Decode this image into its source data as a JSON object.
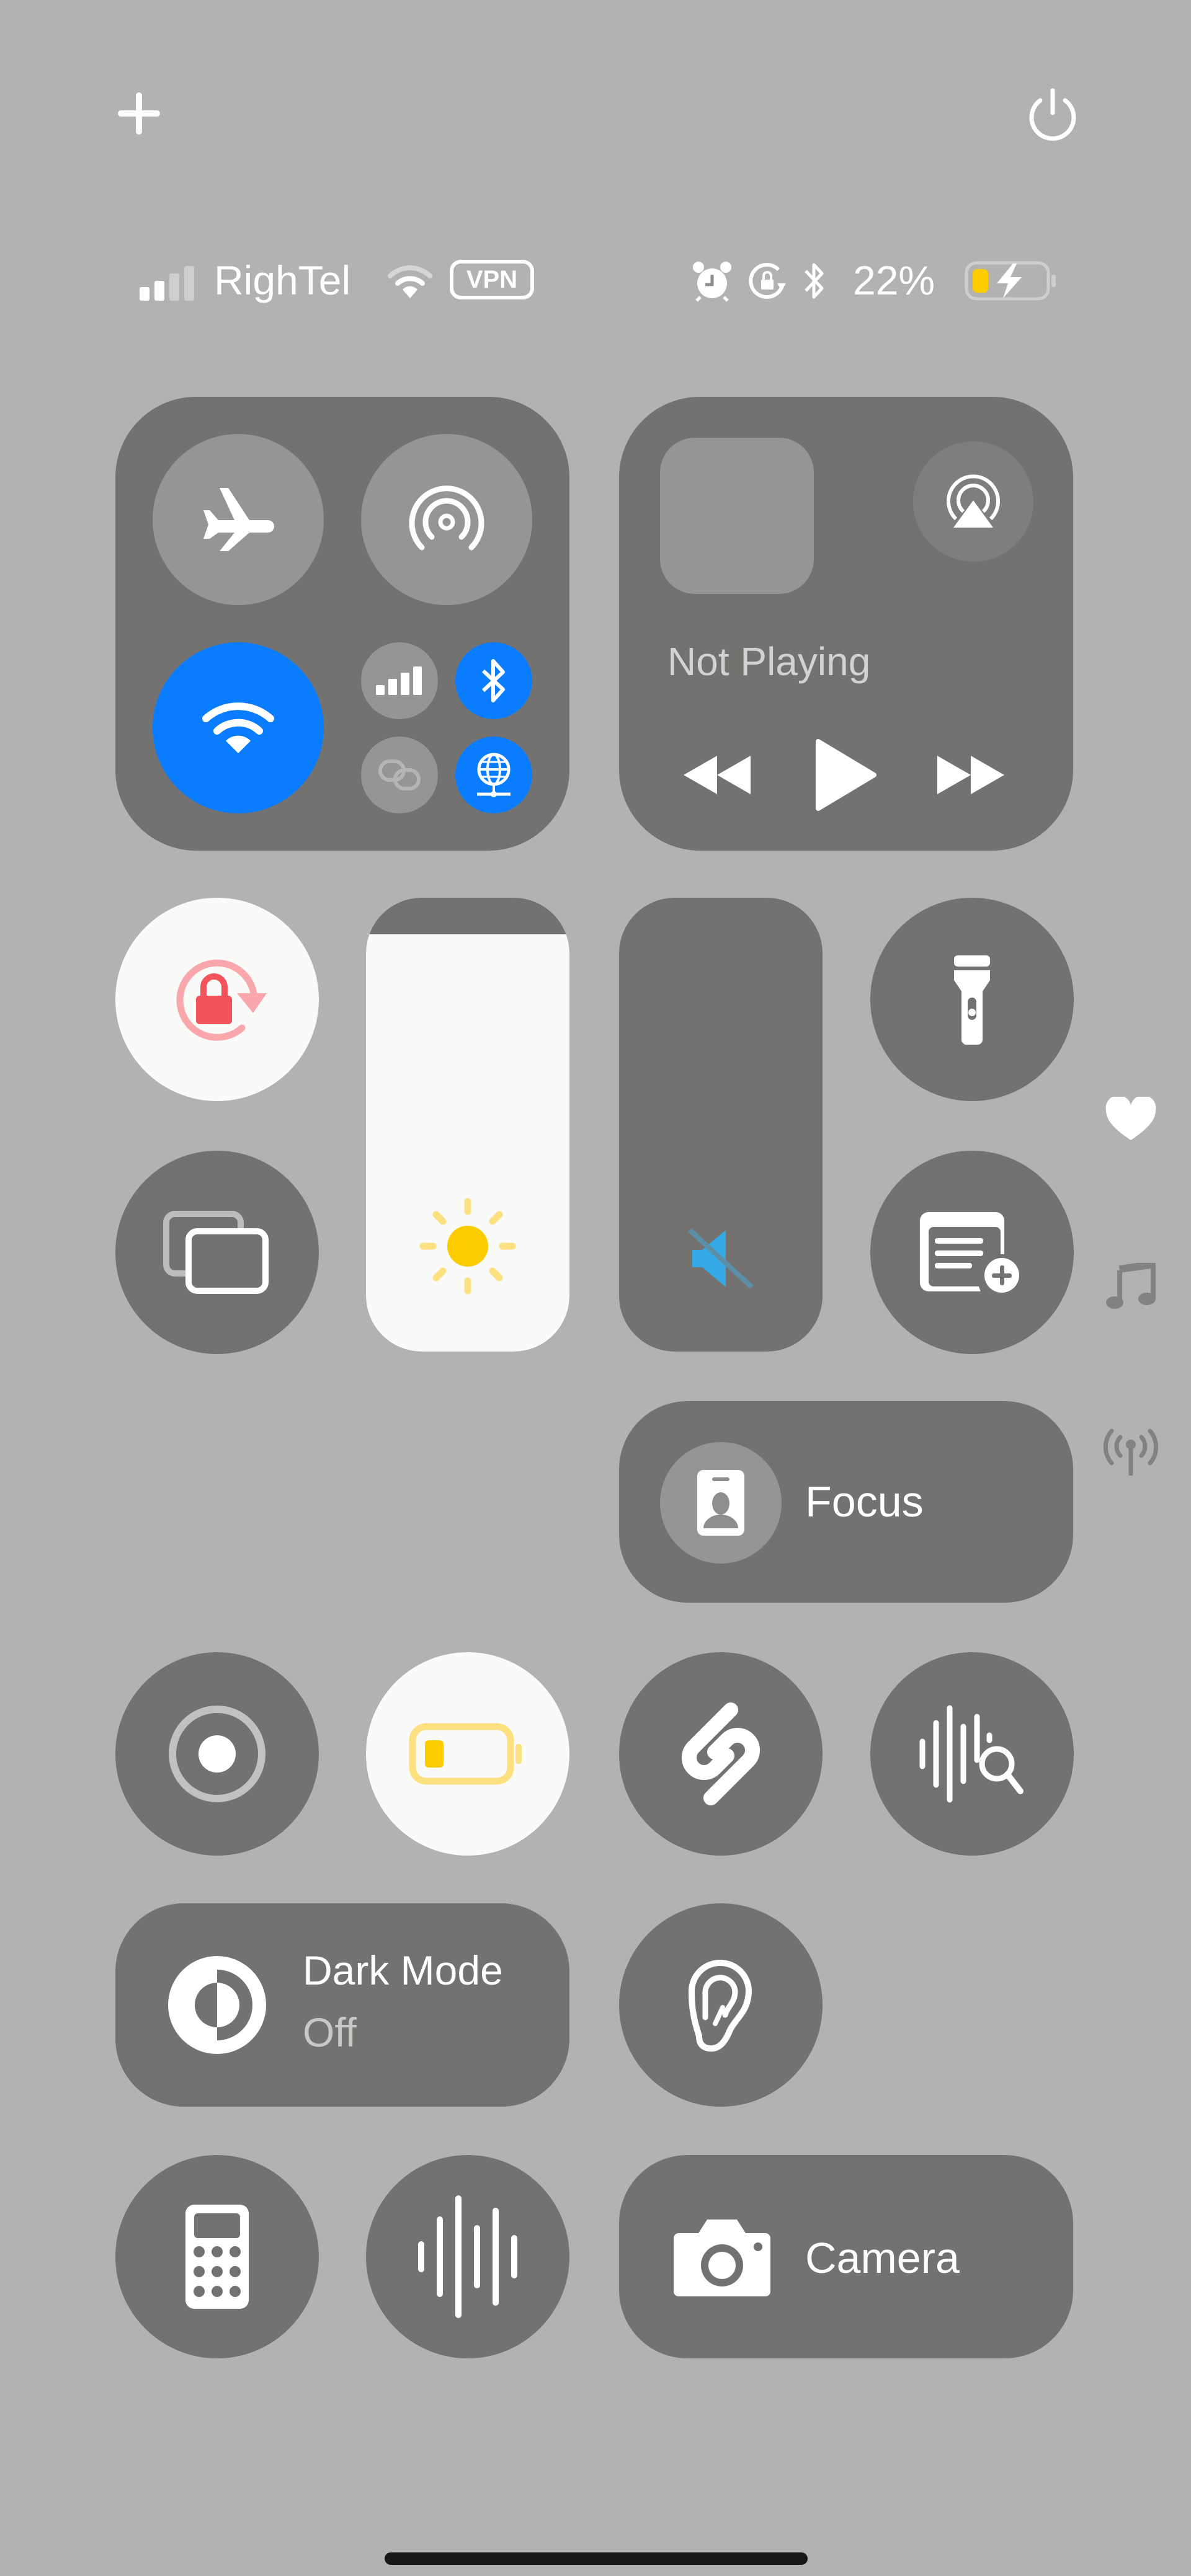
{
  "top_bar": {
    "add_icon": "plus-icon",
    "power_icon": "power-icon"
  },
  "status_bar": {
    "signal_bars_active": 2,
    "signal_bars_total": 4,
    "carrier": "RighTel",
    "wifi_icon": "wifi-icon",
    "vpn_label": "VPN",
    "alarm_icon": "alarm-icon",
    "orientation_lock_icon": "orientation-lock-icon",
    "bluetooth_icon": "bluetooth-icon",
    "battery_percent": "22%",
    "battery_level": 0.22,
    "charging": true
  },
  "connectivity": {
    "airplane_mode": {
      "icon": "airplane-icon",
      "on": false
    },
    "airdrop": {
      "icon": "airdrop-icon",
      "on": false
    },
    "wifi": {
      "icon": "wifi-icon",
      "on": true
    },
    "cellular": {
      "icon": "cellular-icon",
      "on": false
    },
    "bluetooth": {
      "icon": "bluetooth-icon",
      "on": true
    },
    "hotspot": {
      "icon": "personal-hotspot-icon",
      "on": false
    },
    "vpn": {
      "icon": "vpn-globe-icon",
      "on": true
    }
  },
  "media": {
    "status": "Not Playing",
    "airplay_icon": "airplay-audio-icon",
    "controls": [
      "rewind",
      "play",
      "fast-forward"
    ]
  },
  "controls": {
    "orientation_lock": {
      "icon": "orientation-lock-icon",
      "on": true
    },
    "screen_mirroring": {
      "icon": "screen-mirroring-icon"
    },
    "brightness": {
      "icon": "sun-icon",
      "level": 0.92
    },
    "volume": {
      "icon": "speaker-muted-icon",
      "level": 0.0,
      "muted": true
    },
    "flashlight": {
      "icon": "flashlight-icon"
    },
    "quick_note": {
      "icon": "quick-note-icon"
    },
    "focus": {
      "label": "Focus",
      "icon": "person-badge-icon"
    },
    "screen_recording": {
      "icon": "screen-record-icon"
    },
    "low_power_mode": {
      "icon": "low-battery-icon",
      "on": true
    },
    "shazam": {
      "icon": "shazam-icon"
    },
    "music_recognition": {
      "icon": "waveform-search-icon"
    },
    "dark_mode": {
      "label": "Dark Mode",
      "state": "Off",
      "icon": "dark-mode-icon"
    },
    "hearing": {
      "icon": "ear-icon"
    },
    "calculator": {
      "icon": "calculator-icon"
    },
    "voice_memos": {
      "icon": "waveform-icon"
    },
    "camera": {
      "label": "Camera",
      "icon": "camera-icon"
    }
  },
  "page_indicators": {
    "items": [
      {
        "icon": "heart-icon",
        "active": true
      },
      {
        "icon": "music-note-icon",
        "active": false
      },
      {
        "icon": "antenna-icon",
        "active": false
      }
    ]
  },
  "colors": {
    "background": "#b3b2b0",
    "tile": "#737270",
    "tile_light": "#959593",
    "accent_blue": "#0a7cff",
    "orientation_red": "#f2545b",
    "sun_yellow": "#fccc00",
    "muted_blue": "#35a9e5"
  }
}
